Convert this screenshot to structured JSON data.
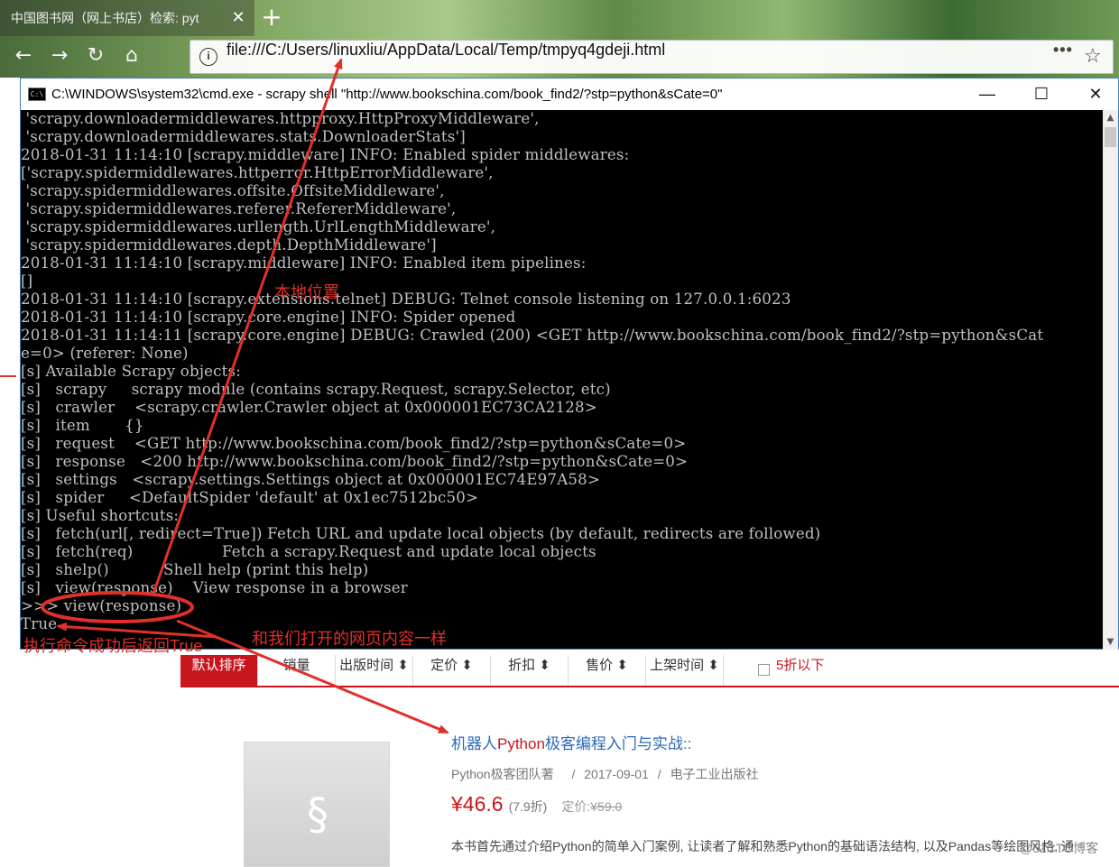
{
  "browser": {
    "tab_title": "中国图书网（网上书店）检索: pyt",
    "tab_close": "✕",
    "new_tab": "+",
    "back": "←",
    "forward": "→",
    "reload": "↻",
    "home": "⌂",
    "url": "file:///C:/Users/linuxliu/AppData/Local/Temp/tmpyq4gdeji.html",
    "info_icon": "i",
    "menu_dots": "•••",
    "star": "☆"
  },
  "cmd": {
    "title": "C:\\WINDOWS\\system32\\cmd.exe - scrapy shell \"http://www.bookschina.com/book_find2/?stp=python&sCate=0\"",
    "icon_text": "C:\\",
    "minimize": "—",
    "maximize": "☐",
    "close": "✕",
    "lines": [
      " 'scrapy.downloadermiddlewares.httpproxy.HttpProxyMiddleware',",
      " 'scrapy.downloadermiddlewares.stats.DownloaderStats']",
      "2018-01-31 11:14:10 [scrapy.middleware] INFO: Enabled spider middlewares:",
      "['scrapy.spidermiddlewares.httperror.HttpErrorMiddleware',",
      " 'scrapy.spidermiddlewares.offsite.OffsiteMiddleware',",
      " 'scrapy.spidermiddlewares.referer.RefererMiddleware',",
      " 'scrapy.spidermiddlewares.urllength.UrlLengthMiddleware',",
      " 'scrapy.spidermiddlewares.depth.DepthMiddleware']",
      "2018-01-31 11:14:10 [scrapy.middleware] INFO: Enabled item pipelines:",
      "[]",
      "2018-01-31 11:14:10 [scrapy.extensions.telnet] DEBUG: Telnet console listening on 127.0.0.1:6023",
      "2018-01-31 11:14:10 [scrapy.core.engine] INFO: Spider opened",
      "2018-01-31 11:14:11 [scrapy.core.engine] DEBUG: Crawled (200) <GET http://www.bookschina.com/book_find2/?stp=python&sCat",
      "e=0> (referer: None)",
      "[s] Available Scrapy objects:",
      "[s]   scrapy     scrapy module (contains scrapy.Request, scrapy.Selector, etc)",
      "[s]   crawler    <scrapy.crawler.Crawler object at 0x000001EC73CA2128>",
      "[s]   item       {}",
      "[s]   request    <GET http://www.bookschina.com/book_find2/?stp=python&sCate=0>",
      "[s]   response   <200 http://www.bookschina.com/book_find2/?stp=python&sCate=0>",
      "[s]   settings   <scrapy.settings.Settings object at 0x000001EC74E97A58>",
      "[s]   spider     <DefaultSpider 'default' at 0x1ec7512bc50>",
      "[s] Useful shortcuts:",
      "[s]   fetch(url[, redirect=True]) Fetch URL and update local objects (by default, redirects are followed)",
      "[s]   fetch(req)                  Fetch a scrapy.Request and update local objects",
      "[s]   shelp()           Shell help (print this help)",
      "[s]   view(response)    View response in a browser",
      ">>> view(response)",
      "True"
    ],
    "scroll_up": "▲",
    "scroll_down": "▼"
  },
  "annotations": {
    "local_location": "本地位置",
    "same_content": "和我们打开的网页内容一样",
    "returns_true": "执行命令成功后返回True",
    "color": "#e0302a"
  },
  "sort_bar": {
    "items": [
      "默认排序",
      "销量",
      "出版时间 ⬍",
      "定价 ⬍",
      "折扣 ⬍",
      "售价 ⬍",
      "上架时间 ⬍"
    ],
    "discount_filter": "5折以下"
  },
  "book": {
    "title_prefix": "机器人",
    "title_highlight": "Python",
    "title_suffix": "极客编程入门与实战::",
    "author": "Python极客团队著",
    "sep1": "/",
    "date": "2017-09-01",
    "sep2": "/",
    "publisher": "电子工业出版社",
    "price": "¥46.6",
    "discount": "(7.9折)",
    "orig_label": "定价:",
    "orig_price": "¥59.0",
    "description": "本书首先通过介绍Python的简单入门案例, 让读者了解和熟悉Python的基础语法结构, 以及Pandas等绘图风格, 通",
    "logo_icon": "§"
  },
  "watermark": "@51CTO博客",
  "colors": {
    "accent_red": "#c9151e",
    "link_blue": "#2b6ab7",
    "terminal_text": "#c0c0c0"
  }
}
